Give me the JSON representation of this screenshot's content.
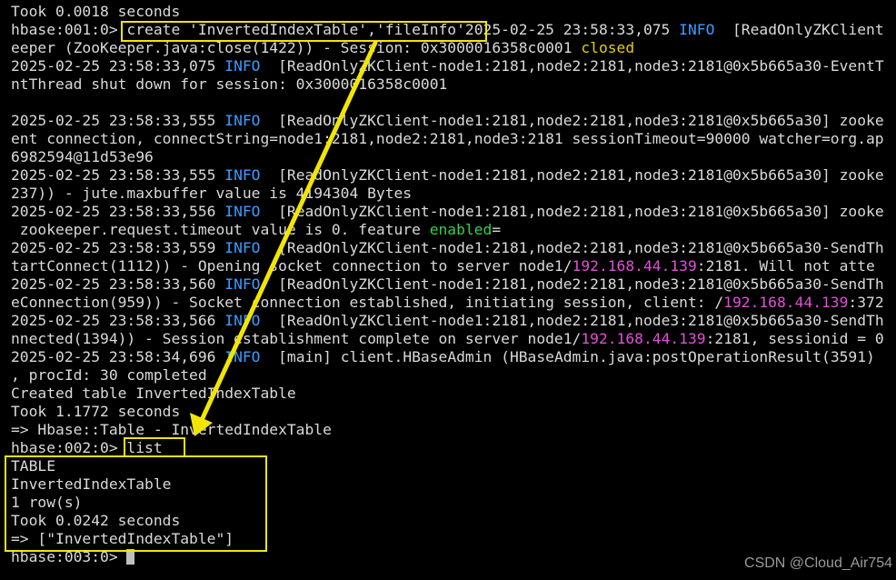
{
  "terminal": {
    "lines": [
      [
        {
          "t": "Took 0.0018 seconds"
        }
      ],
      [
        {
          "t": "hbase:001:0> create 'InvertedIndexTable','fileInfo'2025-02-25 23:58:33,075 "
        },
        {
          "t": "INFO",
          "c": "info"
        },
        {
          "t": "  [ReadOnlyZKClient"
        }
      ],
      [
        {
          "t": "eeper (ZooKeeper.java:close(1422)) - Session: 0x3000016358c0001 "
        },
        {
          "t": "closed",
          "c": "closed"
        }
      ],
      [
        {
          "t": "2025-02-25 23:58:33,075 "
        },
        {
          "t": "INFO",
          "c": "info"
        },
        {
          "t": "  [ReadOnlyZKClient-node1:2181,node2:2181,node3:2181@0x5b665a30-EventT"
        }
      ],
      [
        {
          "t": "ntThread shut down for session: 0x3000016358c0001"
        }
      ],
      [
        {
          "t": ""
        }
      ],
      [
        {
          "t": "2025-02-25 23:58:33,555 "
        },
        {
          "t": "INFO",
          "c": "info"
        },
        {
          "t": "  [ReadOnlyZKClient-node1:2181,node2:2181,node3:2181@0x5b665a30] zooke"
        }
      ],
      [
        {
          "t": "ent connection, connectString=node1:2181,node2:2181,node3:2181 sessionTimeout=90000 watcher=org.ap"
        }
      ],
      [
        {
          "t": "6982594@11d53e96"
        }
      ],
      [
        {
          "t": "2025-02-25 23:58:33,555 "
        },
        {
          "t": "INFO",
          "c": "info"
        },
        {
          "t": "  [ReadOnlyZKClient-node1:2181,node2:2181,node3:2181@0x5b665a30] zooke"
        }
      ],
      [
        {
          "t": "237)) - jute.maxbuffer value is 4194304 Bytes"
        }
      ],
      [
        {
          "t": "2025-02-25 23:58:33,556 "
        },
        {
          "t": "INFO",
          "c": "info"
        },
        {
          "t": "  [ReadOnlyZKClient-node1:2181,node2:2181,node3:2181@0x5b665a30] zooke"
        }
      ],
      [
        {
          "t": " zookeeper.request.timeout value is 0. feature "
        },
        {
          "t": "enabled",
          "c": "enabled"
        },
        {
          "t": "="
        }
      ],
      [
        {
          "t": "2025-02-25 23:58:33,559 "
        },
        {
          "t": "INFO",
          "c": "info"
        },
        {
          "t": "  [ReadOnlyZKClient-node1:2181,node2:2181,node3:2181@0x5b665a30-SendTh"
        }
      ],
      [
        {
          "t": "tartConnect(1112)) - Opening socket connection to server node1/"
        },
        {
          "t": "192.168.44.139",
          "c": "ip"
        },
        {
          "t": ":2181. Will not atte"
        }
      ],
      [
        {
          "t": "2025-02-25 23:58:33,560 "
        },
        {
          "t": "INFO",
          "c": "info"
        },
        {
          "t": "  [ReadOnlyZKClient-node1:2181,node2:2181,node3:2181@0x5b665a30-SendTh"
        }
      ],
      [
        {
          "t": "eConnection(959)) - Socket connection established, initiating session, client: /"
        },
        {
          "t": "192.168.44.139",
          "c": "ip"
        },
        {
          "t": ":372"
        }
      ],
      [
        {
          "t": "2025-02-25 23:58:33,566 "
        },
        {
          "t": "INFO",
          "c": "info"
        },
        {
          "t": "  [ReadOnlyZKClient-node1:2181,node2:2181,node3:2181@0x5b665a30-SendTh"
        }
      ],
      [
        {
          "t": "nnected(1394)) - Session establishment complete on server node1/"
        },
        {
          "t": "192.168.44.139",
          "c": "ip"
        },
        {
          "t": ":2181, sessionid = 0"
        }
      ],
      [
        {
          "t": "2025-02-25 23:58:34,696 "
        },
        {
          "t": "INFO",
          "c": "info"
        },
        {
          "t": "  [main] client.HBaseAdmin (HBaseAdmin.java:postOperationResult(3591)"
        }
      ],
      [
        {
          "t": ", procId: 30 completed"
        }
      ],
      [
        {
          "t": "Created table InvertedIndexTable"
        }
      ],
      [
        {
          "t": "Took 1.1772 seconds"
        }
      ],
      [
        {
          "t": "=> Hbase::Table - InvertedIndexTable"
        }
      ],
      [
        {
          "t": "hbase:002:0> list"
        }
      ],
      [
        {
          "t": "TABLE"
        }
      ],
      [
        {
          "t": "InvertedIndexTable"
        }
      ],
      [
        {
          "t": "1 row(s)"
        }
      ],
      [
        {
          "t": "Took 0.0242 seconds"
        }
      ],
      [
        {
          "t": "=> [\"InvertedIndexTable\"]"
        }
      ],
      [
        {
          "t": "hbase:003:0> "
        },
        {
          "t": "",
          "c": "cursor"
        }
      ]
    ]
  },
  "annotations": {
    "color": "#f2e600"
  },
  "watermark": "CSDN @Cloud_Air754",
  "colors": {
    "background": "#000000",
    "text": "#d9d9d9",
    "info": "#3d9bff",
    "closed": "#e3d000",
    "enabled": "#2fd24e",
    "ip": "#e24fd8"
  }
}
